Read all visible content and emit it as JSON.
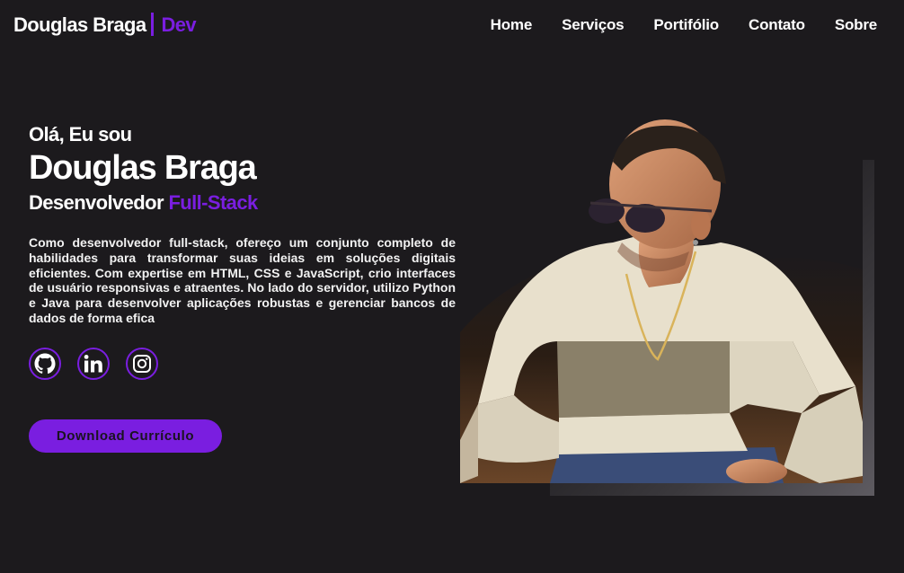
{
  "header": {
    "logo_name": "Douglas Braga",
    "logo_accent": "Dev",
    "nav": [
      "Home",
      "Serviços",
      "Portifólio",
      "Contato",
      "Sobre"
    ]
  },
  "hero": {
    "greeting": "Olá, Eu sou",
    "name": "Douglas Braga",
    "role_prefix": "Desenvolvedor",
    "role_accent": "Full-Stack",
    "description": "Como desenvolvedor full-stack, ofereço um conjunto completo de habilidades para transformar suas ideias em soluções digitais eficientes. Com expertise em HTML, CSS e JavaScript, crio interfaces de usuário responsivas e atraentes. No lado do servidor, utilizo Python e Java para desenvolver aplicações robustas e gerenciar bancos de dados de forma efica",
    "button_label": "Download Currículo"
  },
  "socials": [
    "github-icon",
    "linkedin-icon",
    "instagram-icon"
  ],
  "colors": {
    "background": "#1c1a1d",
    "accent": "#7a1ee0",
    "text": "#ffffff"
  }
}
